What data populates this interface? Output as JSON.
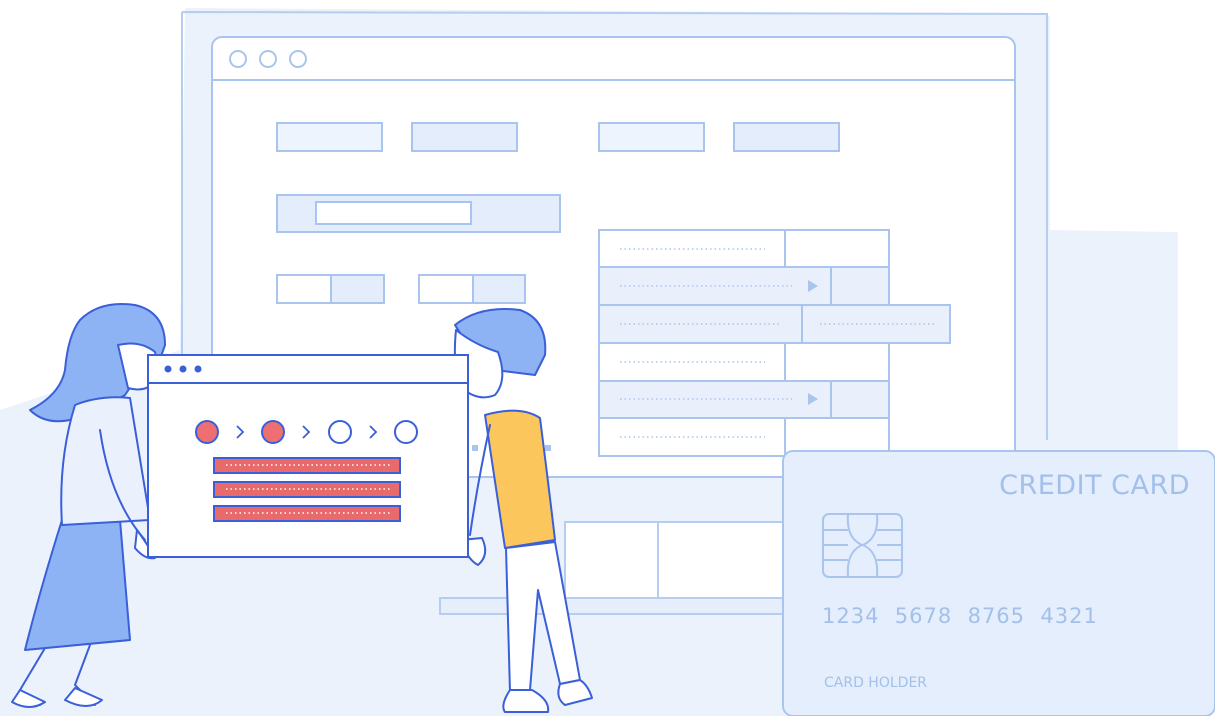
{
  "credit_card": {
    "title": "CREDIT CARD",
    "number": "1234  5678  8765  4321",
    "holder_label": "CARD HOLDER"
  },
  "colors": {
    "background": "#ebf2fc",
    "line_light": "#a9c5ee",
    "line_dark": "#3a5fd9",
    "hair": "#7ea6f0",
    "shirt": "#fbc75c",
    "step_done": "#ee6f72",
    "field_fill": "#e86a6a"
  },
  "icons": {
    "chip": "sim-chip-icon",
    "window_dots": "window-dots-icon",
    "arrow": "play-arrow-icon",
    "chevron": "chevron-right-icon"
  },
  "progress": {
    "steps_total": 4,
    "steps_completed": 2
  }
}
